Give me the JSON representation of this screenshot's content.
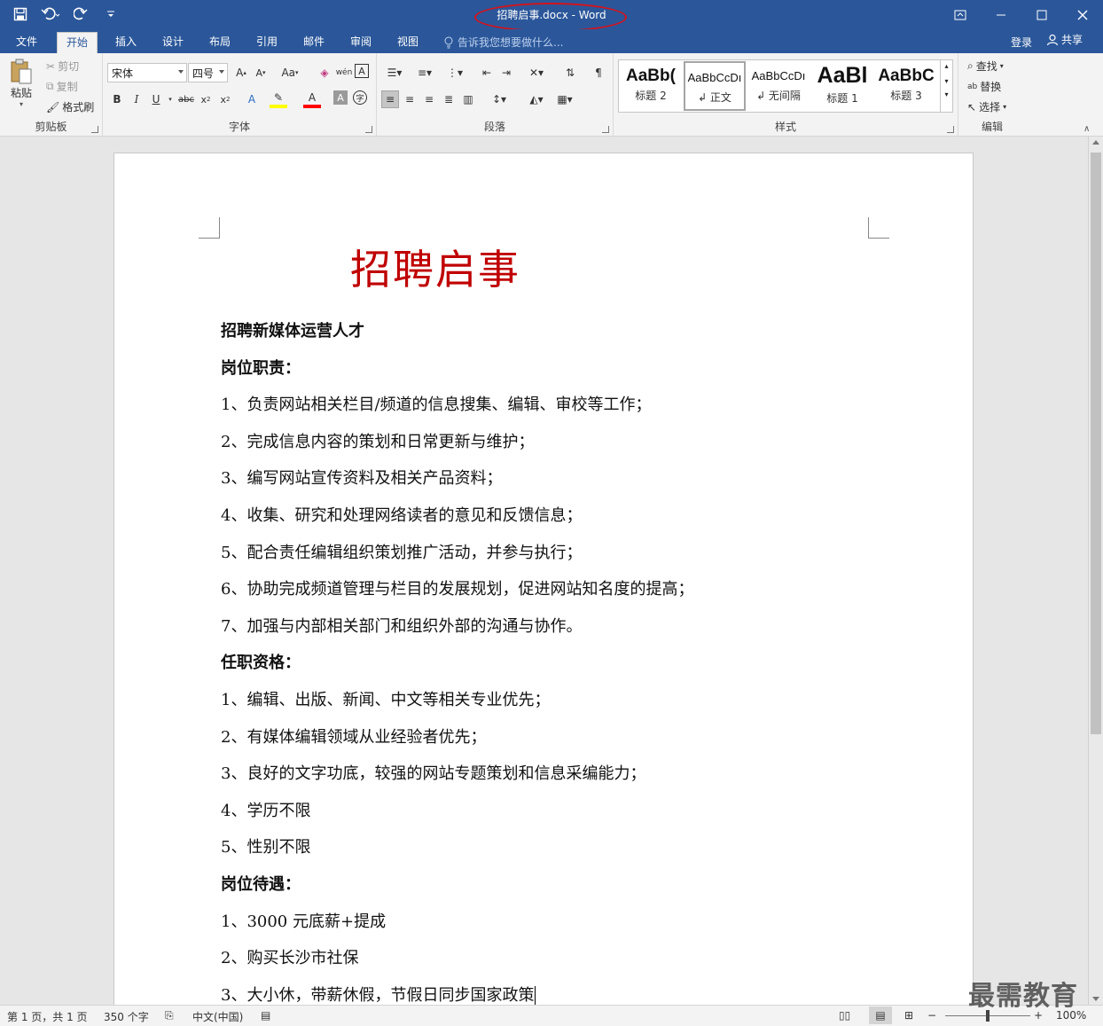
{
  "window": {
    "title": "招聘启事.docx - Word"
  },
  "tabs": [
    {
      "label": "文件"
    },
    {
      "label": "开始"
    },
    {
      "label": "插入"
    },
    {
      "label": "设计"
    },
    {
      "label": "布局"
    },
    {
      "label": "引用"
    },
    {
      "label": "邮件"
    },
    {
      "label": "审阅"
    },
    {
      "label": "视图"
    }
  ],
  "tell_me": "告诉我您想要做什么...",
  "account": {
    "login": "登录",
    "share": "共享"
  },
  "ribbon": {
    "clipboard": {
      "label": "剪贴板",
      "paste": "粘贴",
      "cut": "剪切",
      "copy": "复制",
      "format_painter": "格式刷"
    },
    "font": {
      "label": "字体",
      "font_name": "宋体",
      "font_size": "四号",
      "change_case": "Aa"
    },
    "paragraph": {
      "label": "段落"
    },
    "styles": {
      "label": "样式",
      "items": [
        {
          "sample": "AaBb(",
          "name": "标题 2"
        },
        {
          "sample": "AaBbCcDı",
          "name": "↲ 正文"
        },
        {
          "sample": "AaBbCcDı",
          "name": "↲ 无间隔"
        },
        {
          "sample": "AaBl",
          "name": "标题 1"
        },
        {
          "sample": "AaBbC",
          "name": "标题 3"
        }
      ]
    },
    "editing": {
      "label": "编辑",
      "find": "查找",
      "replace": "替换",
      "select": "选择"
    }
  },
  "document": {
    "heading": "招聘启事",
    "lines": [
      {
        "text": "招聘新媒体运营人才",
        "bold": true
      },
      {
        "text": "岗位职责：",
        "bold": true
      },
      {
        "text": "1、负责网站相关栏目/频道的信息搜集、编辑、审校等工作；",
        "bold": false
      },
      {
        "text": "2、完成信息内容的策划和日常更新与维护；",
        "bold": false
      },
      {
        "text": "3、编写网站宣传资料及相关产品资料；",
        "bold": false
      },
      {
        "text": "4、收集、研究和处理网络读者的意见和反馈信息；",
        "bold": false
      },
      {
        "text": "5、配合责任编辑组织策划推广活动，并参与执行；",
        "bold": false
      },
      {
        "text": "6、协助完成频道管理与栏目的发展规划，促进网站知名度的提高；",
        "bold": false
      },
      {
        "text": "7、加强与内部相关部门和组织外部的沟通与协作。",
        "bold": false
      },
      {
        "text": "任职资格：",
        "bold": true
      },
      {
        "text": "1、编辑、出版、新闻、中文等相关专业优先；",
        "bold": false
      },
      {
        "text": "2、有媒体编辑领域从业经验者优先；",
        "bold": false
      },
      {
        "text": "3、良好的文字功底，较强的网站专题策划和信息采编能力；",
        "bold": false
      },
      {
        "text": "4、学历不限",
        "bold": false
      },
      {
        "text": "5、性别不限",
        "bold": false
      },
      {
        "text": "岗位待遇：",
        "bold": true
      },
      {
        "text": "1、3000 元底薪+提成",
        "bold": false
      },
      {
        "text": "2、购买长沙市社保",
        "bold": false
      },
      {
        "text": "3、大小休，带薪休假，节假日同步国家政策",
        "bold": false
      }
    ]
  },
  "status": {
    "page": "第 1 页，共 1 页",
    "words": "350 个字",
    "language": "中文(中国)",
    "zoom": "100%",
    "zoom_level": 1.0
  },
  "watermark": "最需教育",
  "colors": {
    "brand": "#2b579a",
    "heading": "#c00000",
    "annotation": "#d4131b"
  }
}
